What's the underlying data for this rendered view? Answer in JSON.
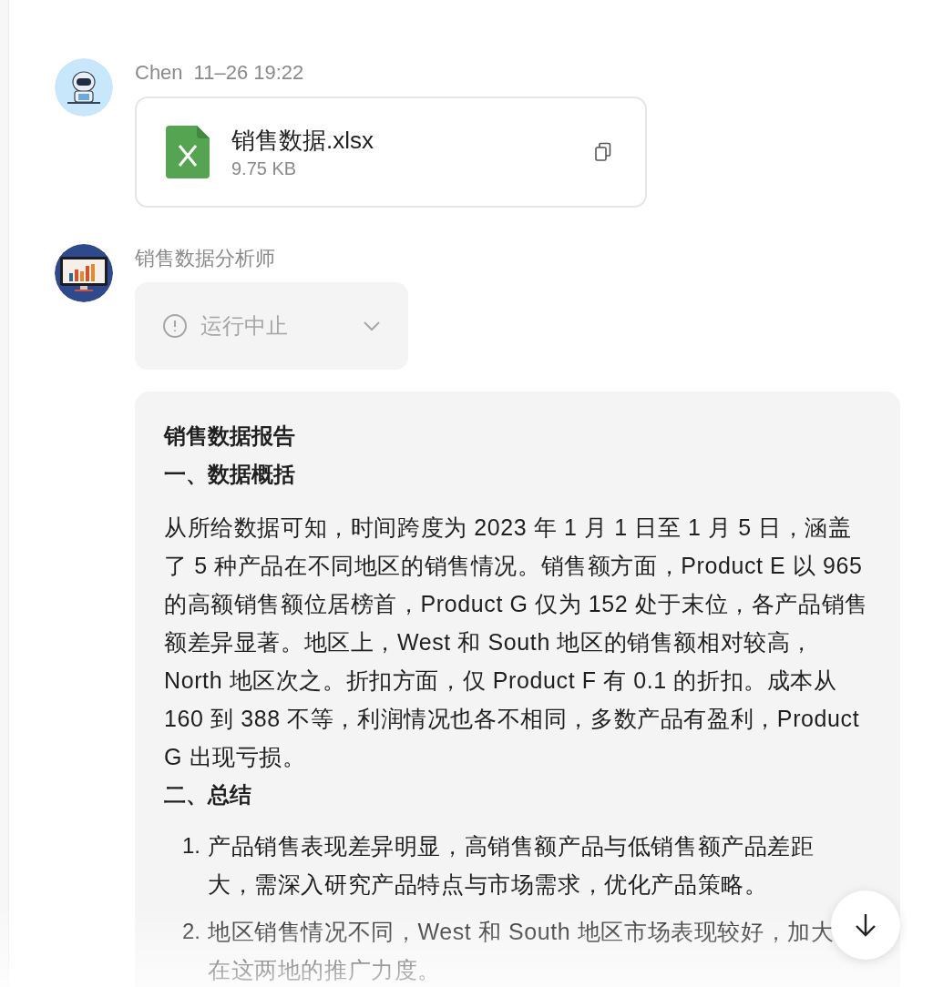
{
  "messages": [
    {
      "kind": "file",
      "sender": "Chen",
      "time": "11–26 19:22",
      "file": {
        "name": "销售数据.xlsx",
        "size": "9.75 KB"
      }
    },
    {
      "kind": "report",
      "sender": "销售数据分析师",
      "status": {
        "label": "运行中止",
        "expanded": false
      },
      "report": {
        "title": "销售数据报告",
        "sections": [
          {
            "kind": "paragraph",
            "heading": "一、数据概括",
            "text": "从所给数据可知，时间跨度为 2023 年 1 月 1 日至 1 月 5 日，涵盖了 5 种产品在不同地区的销售情况。销售额方面，Product E 以 965 的高额销售额位居榜首，Product G 仅为 152 处于末位，各产品销售额差异显著。地区上，West 和 South 地区的销售额相对较高，North 地区次之。折扣方面，仅 Product F 有 0.1 的折扣。成本从 160 到 388 不等，利润情况也各不相同，多数产品有盈利，Product G 出现亏损。"
          },
          {
            "kind": "list",
            "heading": "二、总结",
            "items": [
              {
                "marker": "1.",
                "text": "产品销售表现差异明显，高销售额产品与低销售额产品差距大，需深入研究产品特点与市场需求，优化产品策略。"
              },
              {
                "marker": "2.",
                "text": "地区销售情况不同，West 和 South 地区市场表现较好，加大在这两地的推广力度。"
              }
            ]
          }
        ]
      }
    }
  ]
}
